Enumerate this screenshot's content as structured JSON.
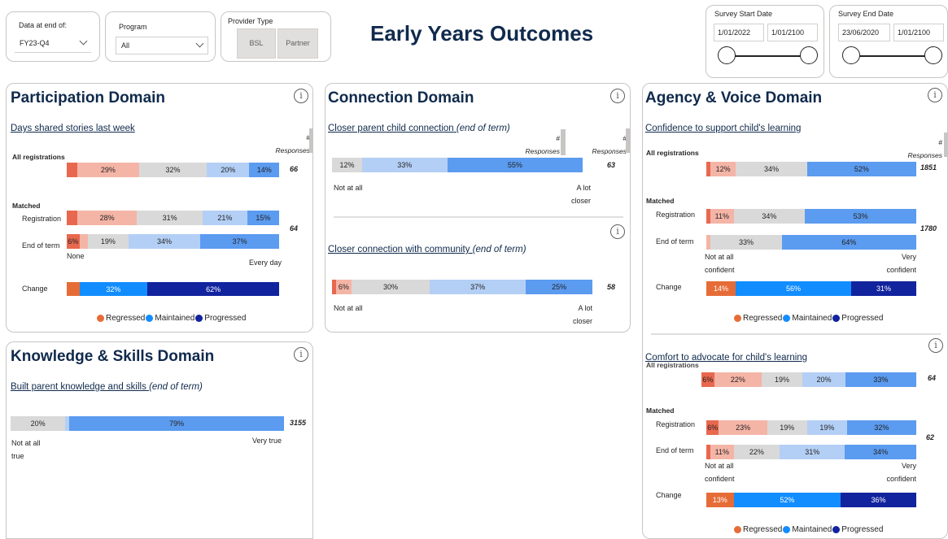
{
  "title": "Early Years Outcomes",
  "filters": {
    "data_at_end": {
      "label": "Data at end of:",
      "value": "FY23-Q4"
    },
    "program": {
      "label": "Program",
      "value": "All"
    },
    "provider": {
      "label": "Provider Type",
      "options": [
        "BSL",
        "Partner"
      ]
    },
    "survey_start": {
      "label": "Survey Start Date",
      "from": "1/01/2022",
      "to": "1/01/2100"
    },
    "survey_end": {
      "label": "Survey End Date",
      "from": "23/06/2020",
      "to": "1/01/2100"
    }
  },
  "colors": {
    "strong_neg": "#e66c37",
    "neg_dark": "#e8684f",
    "neg_light": "#f4b5a7",
    "neutral": "#d9d9d9",
    "pos_light": "#b4cff5",
    "pos": "#5b9bf0",
    "regressed": "#e66c37",
    "maintained": "#118dff",
    "progressed": "#12239e",
    "title": "#102a4c"
  },
  "legend": {
    "regressed": "Regressed",
    "maintained": "Maintained",
    "progressed": "Progressed"
  },
  "common": {
    "hash": "#",
    "responses": "Responses",
    "all_registrations": "All registrations",
    "matched": "Matched",
    "registration": "Registration",
    "end_of_term": "End of term",
    "change": "Change",
    "info": "i"
  },
  "participation": {
    "title": "Participation Domain",
    "question": "Days shared stories last week",
    "all": {
      "labels": [
        "",
        "29%",
        "32%",
        "20%",
        "14%"
      ],
      "count": "66"
    },
    "registration": {
      "labels": [
        "",
        "28%",
        "31%",
        "21%",
        "15%"
      ]
    },
    "end": {
      "labels": [
        "6%",
        "",
        "19%",
        "34%",
        "37%"
      ]
    },
    "matched_count": "64",
    "axis_left": "None",
    "axis_right": "Every day",
    "change": {
      "labels": [
        "",
        "32%",
        "62%"
      ]
    }
  },
  "connection": {
    "title": "Connection Domain",
    "q1": {
      "title": "Closer parent child connection",
      "suffix": "(end of term)",
      "labels": [
        "12%",
        "33%",
        "55%"
      ],
      "count": "63",
      "axis_left": "Not at all",
      "axis_right": "A lot closer"
    },
    "q2": {
      "title": "Closer connection with community",
      "suffix": "(end of term)",
      "labels": [
        "",
        "6%",
        "30%",
        "37%",
        "25%"
      ],
      "count": "58",
      "axis_left": "Not at all",
      "axis_right": "A lot closer"
    }
  },
  "knowledge": {
    "title": "Knowledge & Skills Domain",
    "question": "Built parent knowledge and skills",
    "suffix": "(end of term)",
    "labels": [
      "20%",
      "",
      "79%"
    ],
    "count": "3155",
    "axis_left": "Not at all true",
    "axis_right": "Very true"
  },
  "agency": {
    "title": "Agency & Voice Domain",
    "q1": {
      "title": "Confidence to support child's learning",
      "all": {
        "labels": [
          "",
          "12%",
          "34%",
          "52%"
        ],
        "count": "1851"
      },
      "registration": {
        "labels": [
          "",
          "11%",
          "34%",
          "53%"
        ]
      },
      "end": {
        "labels": [
          "",
          "33%",
          "64%"
        ]
      },
      "matched_count": "1780",
      "axis_left": "Not at all confident",
      "axis_right": "Very confident",
      "change": {
        "labels": [
          "14%",
          "56%",
          "31%"
        ]
      }
    },
    "q2": {
      "title": "Comfort to advocate for child's learning",
      "all": {
        "labels": [
          "6%",
          "22%",
          "19%",
          "20%",
          "33%"
        ],
        "count": "64"
      },
      "registration": {
        "labels": [
          "6%",
          "23%",
          "19%",
          "19%",
          "32%"
        ]
      },
      "end": {
        "labels": [
          "",
          "11%",
          "22%",
          "31%",
          "34%"
        ]
      },
      "matched_count": "62",
      "axis_left": "Not at all confident",
      "axis_right": "Very confident",
      "change": {
        "labels": [
          "13%",
          "52%",
          "36%"
        ]
      }
    }
  }
}
